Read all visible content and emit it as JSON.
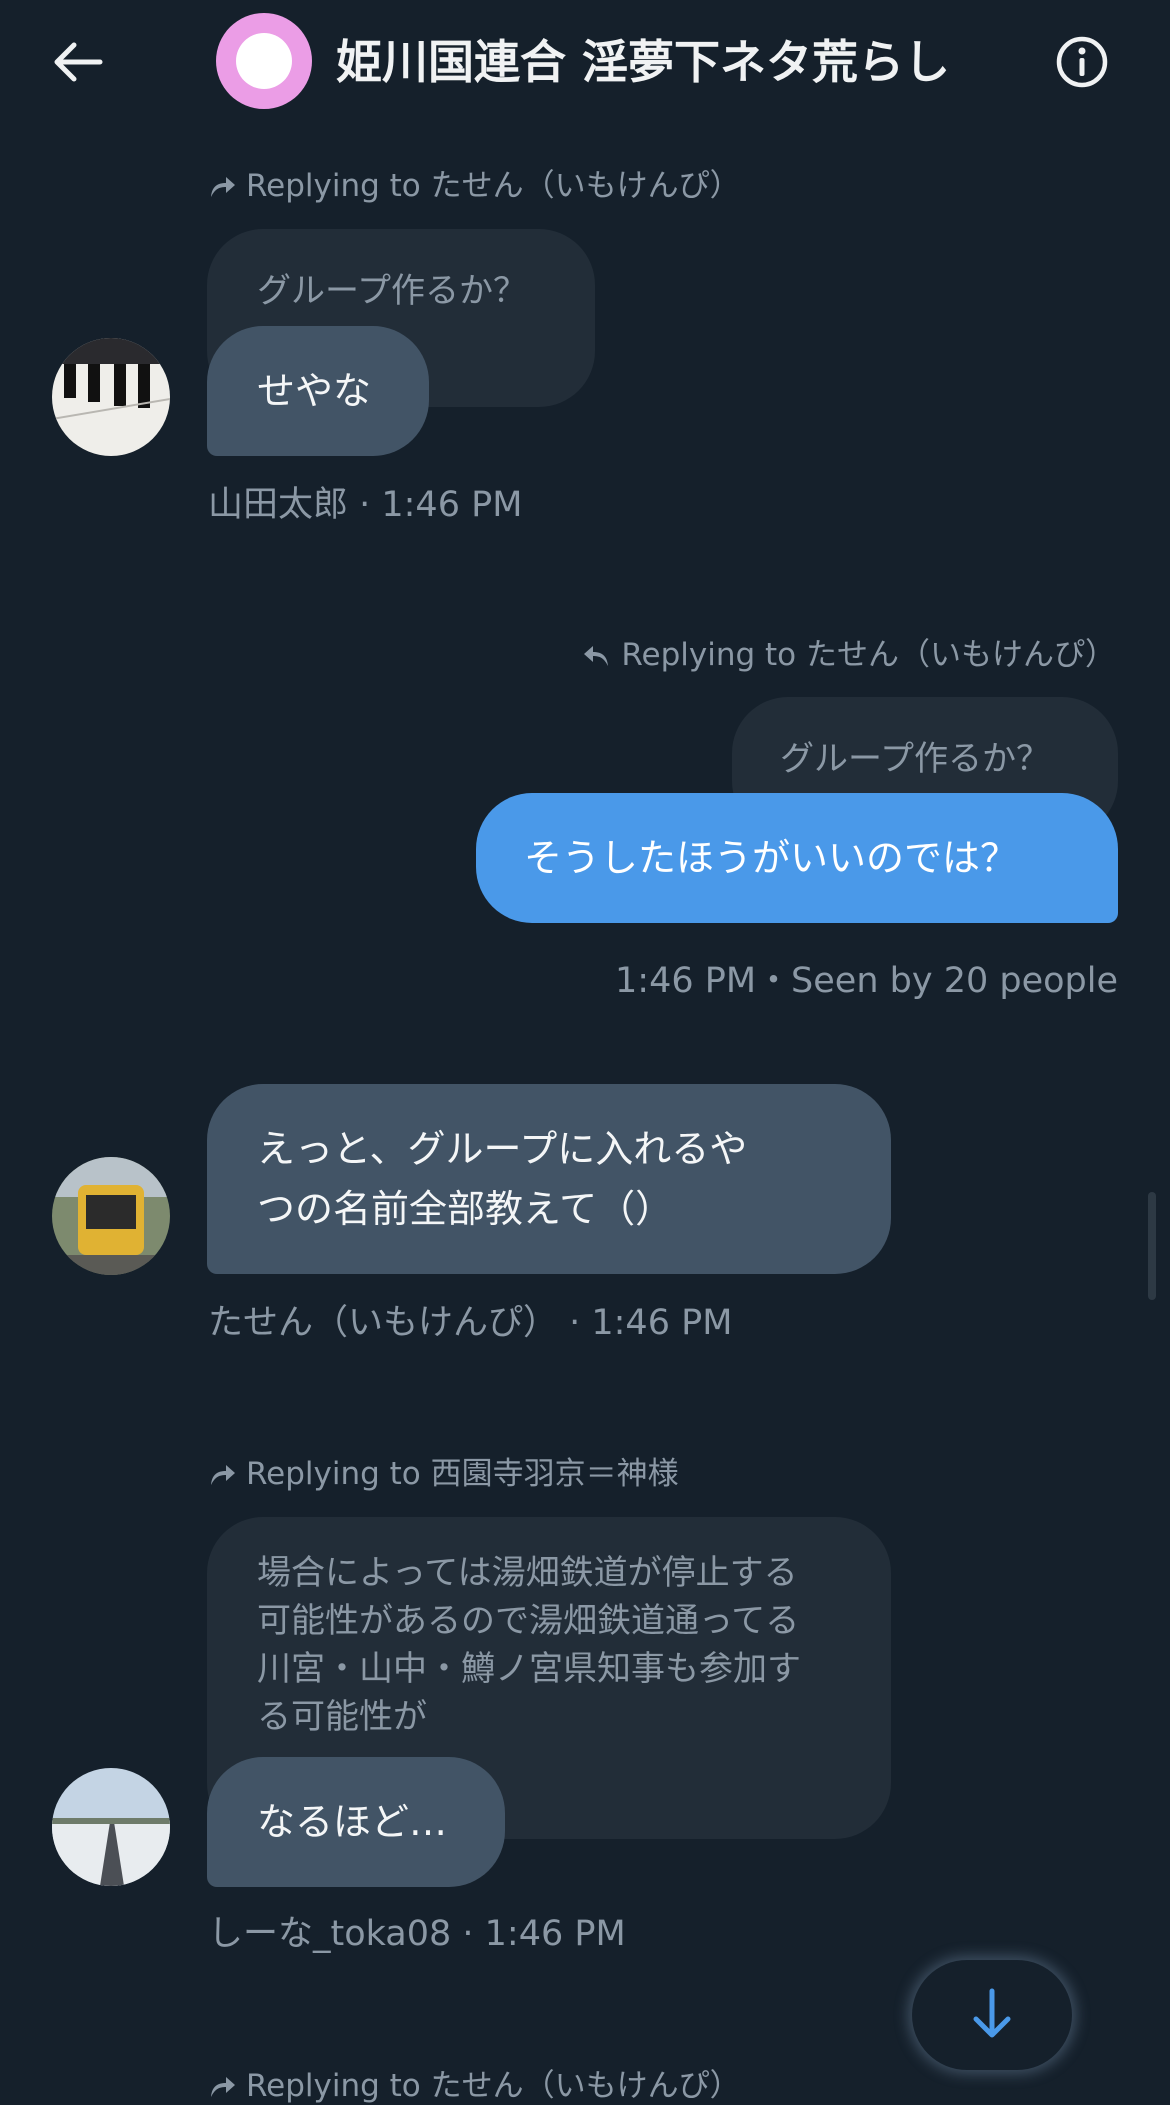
{
  "header": {
    "title": "姫川国連合 淫夢下ネタ荒らし"
  },
  "messages": [
    {
      "reply": "Replying to たせん（いもけんぴ）",
      "quote": "グループ作るか？",
      "text": "せやな",
      "meta": "山田太郎 · 1:46 PM"
    },
    {
      "reply": "Replying to たせん（いもけんぴ）",
      "quote": "グループ作るか？",
      "text": "そうしたほうがいいのでは？",
      "meta": "1:46 PM・Seen by 20 people"
    },
    {
      "text_line1": "えっと、グループに入れるや",
      "text_line2": "つの名前全部教えて（）",
      "meta": "たせん（いもけんぴ） · 1:46 PM"
    },
    {
      "reply": "Replying to 西園寺羽京＝神様",
      "quote_lines": [
        "場合によっては湯畑鉄道が停止する",
        "可能性があるので湯畑鉄道通ってる",
        "川宮・山中・鱒ノ宮県知事も参加す",
        "る可能性が"
      ],
      "text": "なるほど…",
      "meta": "しーな_toka08 · 1:46 PM"
    },
    {
      "reply": "Replying to たせん（いもけんぴ）"
    }
  ],
  "colors": {
    "background": "#15202b",
    "bubble_other": "#425466",
    "bubble_mine": "#4a99e9",
    "quote": "#222d38",
    "muted": "#8b98a5"
  },
  "icons": [
    "back-arrow-icon",
    "info-icon",
    "reply-arrow-icon",
    "scroll-down-icon"
  ]
}
